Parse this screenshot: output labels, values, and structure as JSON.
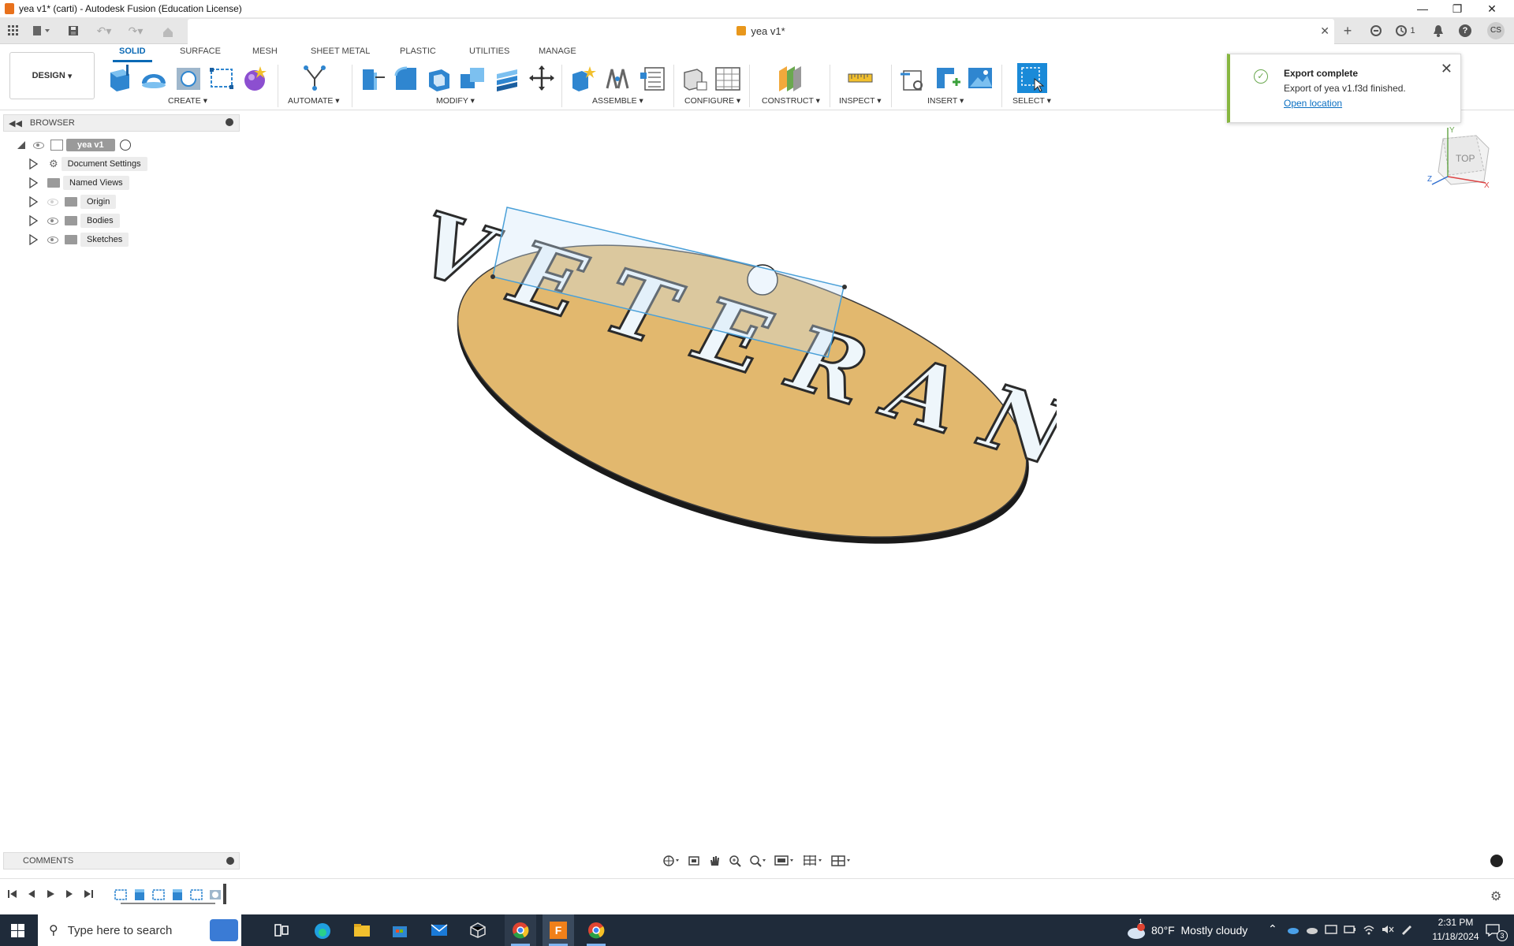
{
  "window": {
    "title": "yea v1* (carti) - Autodesk Fusion (Education License)",
    "min_icon": "minimize-icon",
    "restore_icon": "restore-icon",
    "close_icon": "close-icon"
  },
  "doc_tab": {
    "label": "yea v1*"
  },
  "header_right": {
    "jobs_count": "1",
    "user_initials": "CS"
  },
  "workspace": {
    "mode": "DESIGN"
  },
  "ws_tabs": [
    "SOLID",
    "SURFACE",
    "MESH",
    "SHEET METAL",
    "PLASTIC",
    "UTILITIES",
    "MANAGE"
  ],
  "tool_groups": [
    "CREATE",
    "AUTOMATE",
    "MODIFY",
    "ASSEMBLE",
    "CONFIGURE",
    "CONSTRUCT",
    "INSPECT",
    "INSERT",
    "SELECT"
  ],
  "browser": {
    "title": "BROWSER",
    "root": "yea v1",
    "items": [
      "Document Settings",
      "Named Views",
      "Origin",
      "Bodies",
      "Sketches"
    ]
  },
  "toast": {
    "title": "Export complete",
    "message": "Export of yea v1.f3d finished.",
    "link": "Open location"
  },
  "viewcube": {
    "face": "TOP",
    "axis_x": "X",
    "axis_y": "Y",
    "axis_z": "Z"
  },
  "model": {
    "text": "VETERAN",
    "plate_color": "#e2b86e"
  },
  "comments": {
    "title": "COMMENTS"
  },
  "taskbar": {
    "search_placeholder": "Type here to search",
    "weather": "80°F  Mostly cloudy",
    "weather_badge": "1",
    "time": "2:31 PM",
    "date": "11/18/2024",
    "notif_count": "3"
  },
  "colors": {
    "accent": "#0a69b5",
    "taskbar": "#1f2b3a",
    "toast_success": "#87b640"
  }
}
